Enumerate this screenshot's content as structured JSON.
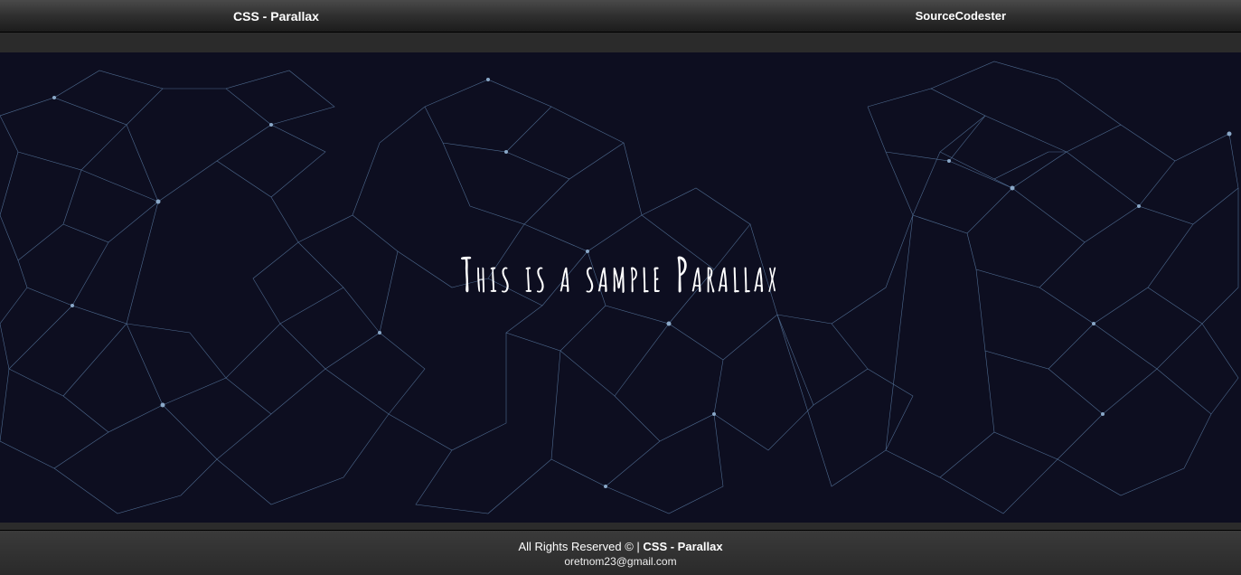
{
  "navbar": {
    "title": "CSS - Parallax",
    "site": "SourceCodester"
  },
  "hero": {
    "headline": "This is a sample Parallax"
  },
  "footer": {
    "rights_prefix": "All Rights Reserved © | ",
    "rights_bold": "CSS - Parallax",
    "email": "oretnom23@gmail.com"
  }
}
